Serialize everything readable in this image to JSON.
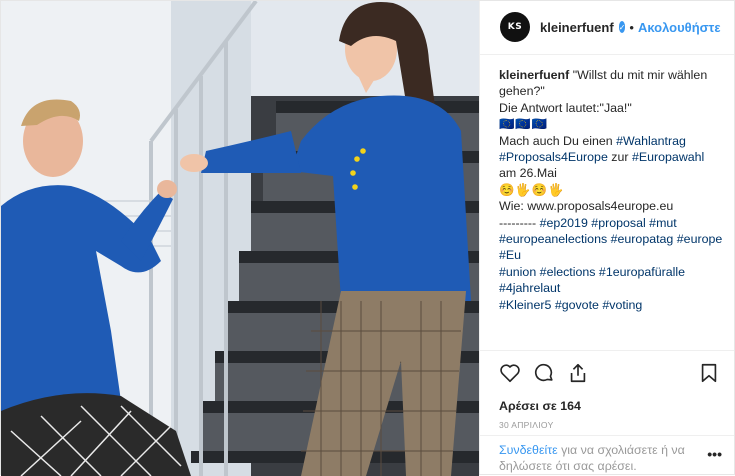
{
  "header": {
    "avatar_text": "KS",
    "username": "kleinerfuenf",
    "follow_label": "Ακολουθήστε",
    "dot": "•"
  },
  "caption": {
    "username": "kleinerfuenf",
    "line1": "\"Willst du mit mir wählen gehen?\"",
    "line2": "Die Antwort lautet:\"Jaa!\"",
    "flags": "🇪🇺🇪🇺🇪🇺",
    "line3_prefix": "Mach auch Du einen",
    "tag_wahlantrag": "#Wahlantrag",
    "tag_proposals": "#Proposals4Europe",
    "line4_mid": "zur",
    "tag_europawahl": "#Europawahl",
    "line4_suffix": "am 26.Mai",
    "emoji_line": "☺️🖐☺️🖐",
    "web_line": "Wie: www.proposals4europe.eu",
    "dashes": "---------",
    "tags": [
      "#ep2019",
      "#proposal",
      "#mut",
      "#europeanelections",
      "#europatag",
      "#europe",
      "#Eu",
      "#union",
      "#elections",
      "#1europafüralle",
      "#4jahrelaut",
      "#Kleiner5",
      "#govote",
      "#voting"
    ]
  },
  "actions": {
    "like_icon": "heart-icon",
    "comment_icon": "comment-icon",
    "share_icon": "share-icon",
    "save_icon": "bookmark-icon"
  },
  "likes_text": "Αρέσει σε 164",
  "date_text": "30 ΑΠΡΙΛΙΟΥ",
  "login": {
    "link": "Συνδεθείτε",
    "rest": "για να σχολιάσετε ή να δηλώσετε ότι σας αρέσει.",
    "more": "•••"
  },
  "colors": {
    "link_blue": "#3897f0",
    "hashtag_blue": "#003569",
    "sweater_blue": "#1f5bb5"
  }
}
